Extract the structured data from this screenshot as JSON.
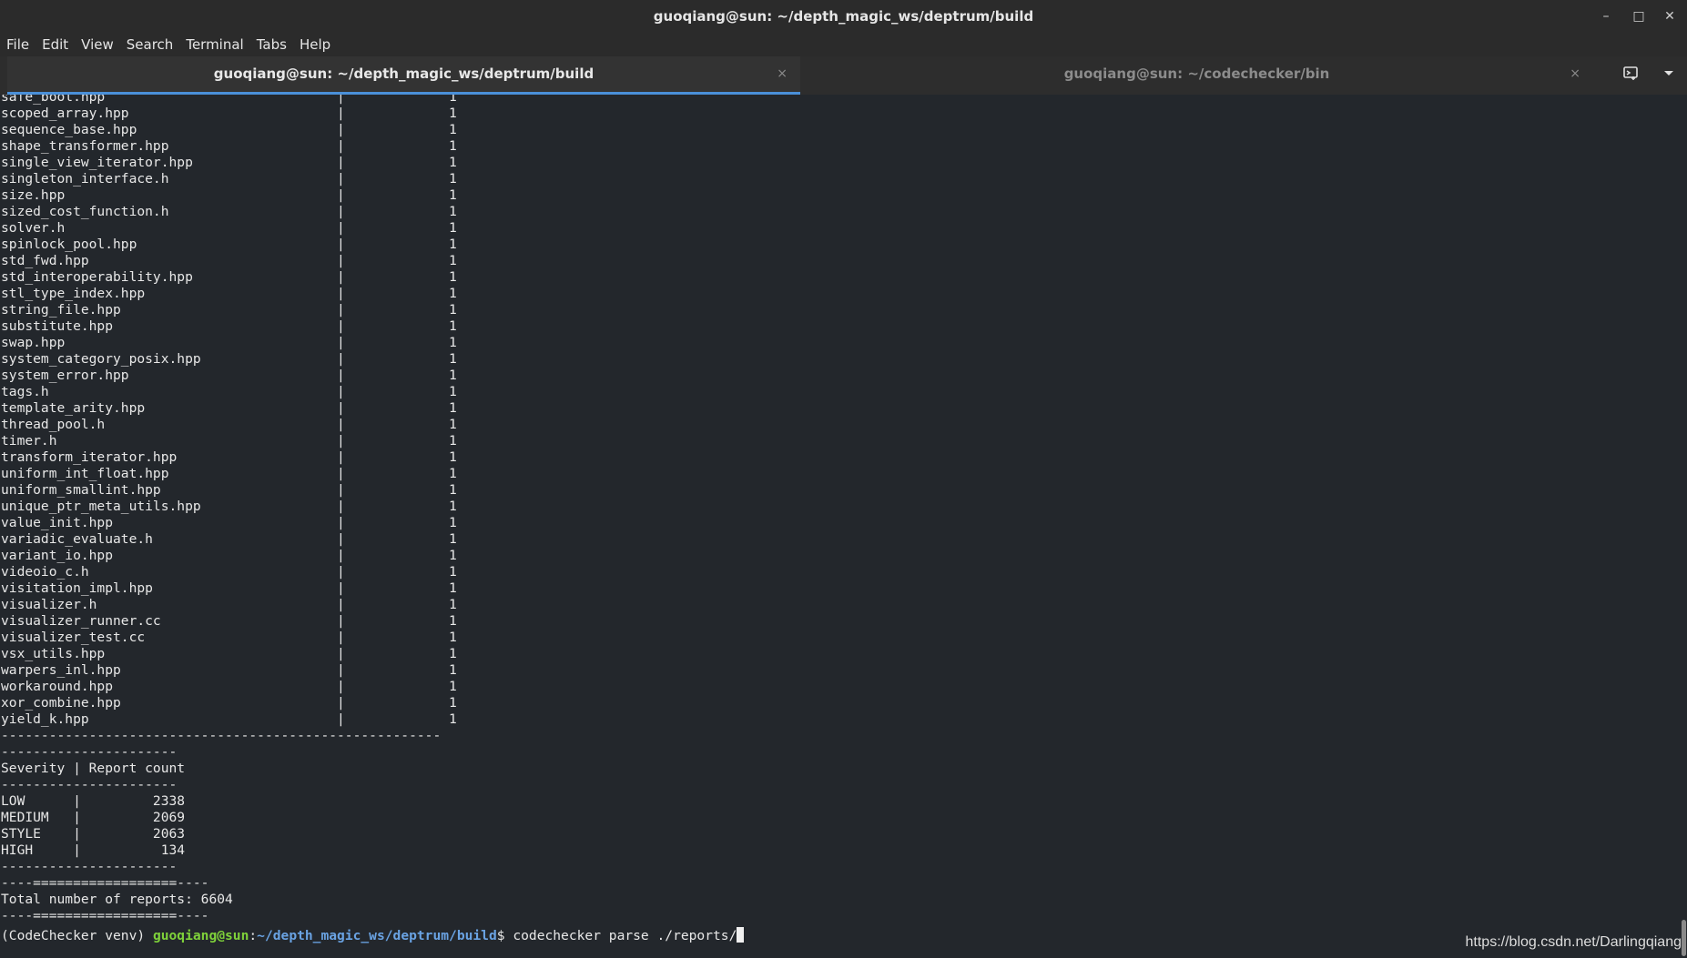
{
  "window": {
    "title": "guoqiang@sun: ~/depth_magic_ws/deptrum/build",
    "minimize_icon": "minimize-icon",
    "maximize_icon": "maximize-icon",
    "close_icon": "close-icon"
  },
  "menu": {
    "file": "File",
    "edit": "Edit",
    "view": "View",
    "search": "Search",
    "terminal": "Terminal",
    "tabs": "Tabs",
    "help": "Help"
  },
  "tabs": [
    {
      "label": "guoqiang@sun: ~/depth_magic_ws/deptrum/build",
      "active": true
    },
    {
      "label": "guoqiang@sun: ~/codechecker/bin",
      "active": false
    }
  ],
  "tab_close_glyph": "×",
  "terminal": {
    "file_rows": [
      "safe_bool.hpp",
      "scoped_array.hpp",
      "sequence_base.hpp",
      "shape_transformer.hpp",
      "single_view_iterator.hpp",
      "singleton_interface.h",
      "size.hpp",
      "sized_cost_function.h",
      "solver.h",
      "spinlock_pool.hpp",
      "std_fwd.hpp",
      "std_interoperability.hpp",
      "stl_type_index.hpp",
      "string_file.hpp",
      "substitute.hpp",
      "swap.hpp",
      "system_category_posix.hpp",
      "system_error.hpp",
      "tags.h",
      "template_arity.hpp",
      "thread_pool.h",
      "timer.h",
      "transform_iterator.hpp",
      "uniform_int_float.hpp",
      "uniform_smallint.hpp",
      "unique_ptr_meta_utils.hpp",
      "value_init.hpp",
      "variadic_evaluate.h",
      "variant_io.hpp",
      "videoio_c.h",
      "visitation_impl.hpp",
      "visualizer.h",
      "visualizer_runner.cc",
      "visualizer_test.cc",
      "vsx_utils.hpp",
      "warpers_inl.hpp",
      "workaround.hpp",
      "xor_combine.hpp",
      "yield_k.hpp"
    ],
    "file_count": "1",
    "file_table_rule": "-------------------------------------------------------",
    "severity_rule": "----------------------",
    "severity_header": "Severity | Report count",
    "severity_rows": [
      {
        "severity": "LOW",
        "count": "2338"
      },
      {
        "severity": "MEDIUM",
        "count": "2069"
      },
      {
        "severity": "STYLE",
        "count": "2063"
      },
      {
        "severity": "HIGH",
        "count": "134"
      }
    ],
    "total_rule": "----==================----",
    "total_line": "Total number of reports: 6604",
    "prompt_env": "(CodeChecker venv) ",
    "prompt_user": "guoqiang@sun",
    "prompt_sep": ":",
    "prompt_path": "~/depth_magic_ws/deptrum/build",
    "prompt_dollar": "$ ",
    "command": "codechecker parse ./reports/"
  },
  "watermark": "https://blog.csdn.net/Darlingqiang",
  "colors": {
    "background": "#23272c",
    "prompt_user": "#7fd23a",
    "prompt_path": "#6aa3e3",
    "active_tab_underline": "#4a90d9"
  }
}
